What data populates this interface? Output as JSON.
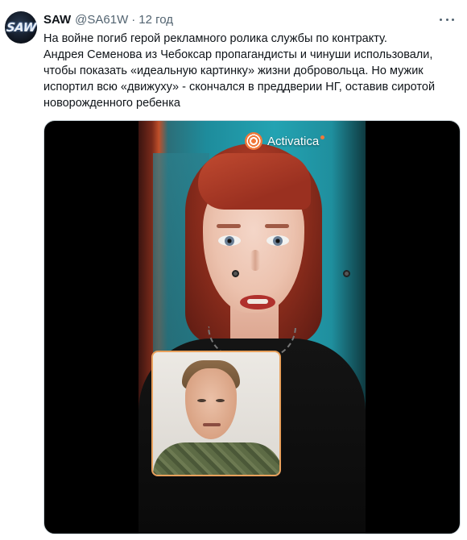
{
  "tweet": {
    "display_name": "SAW",
    "handle": "@SA61W",
    "separator": "·",
    "time": "12 год",
    "avatar_text": "SAW",
    "text": "На войне погиб герой рекламного ролика службы по контракту.\nАндрея Семенова из Чебоксар пропагандисты и чинуши использовали,\nчтобы показать «идеальную картинку» жизни добровольца. Но мужик\nиспортил всю «движуху» - скончался в преддверии НГ, оставив сиротой\nноворожденного ребенка",
    "more_icon": "ellipsis-icon"
  },
  "media": {
    "brand_text": "Activatica",
    "brand_icon": "activatica-logo-icon",
    "accent_color": "#f0783a"
  }
}
